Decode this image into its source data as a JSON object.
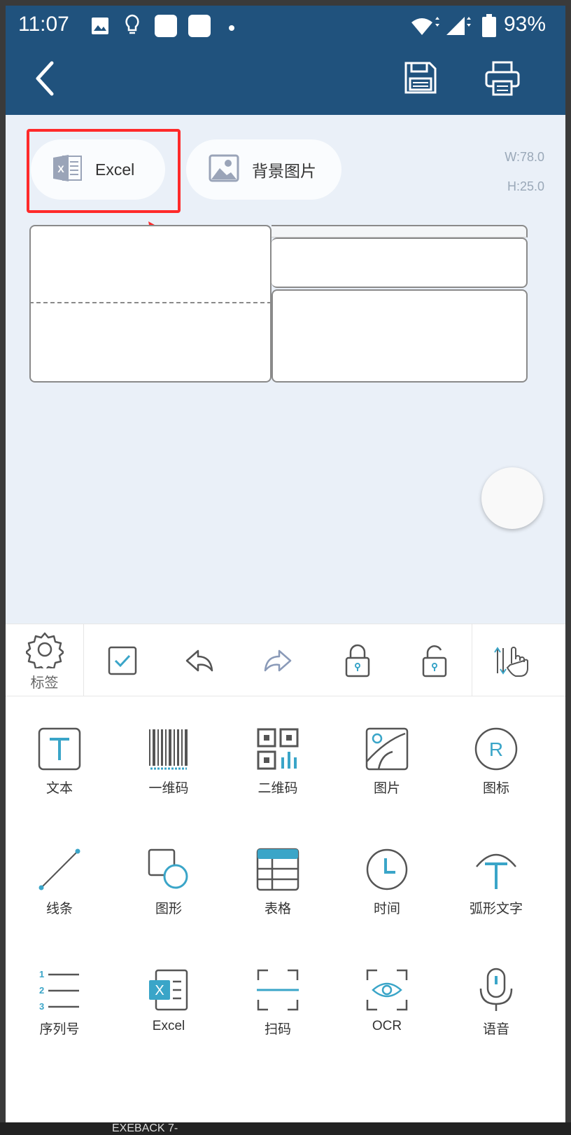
{
  "status_bar": {
    "time": "11:07",
    "battery": "93%"
  },
  "canvas": {
    "excel_button": "Excel",
    "background_button": "背景图片",
    "width_label": "W:78.0",
    "height_label": "H:25.0"
  },
  "toolbar": {
    "settings_label": "标签"
  },
  "tools": [
    {
      "label": "文本",
      "icon": "text-icon"
    },
    {
      "label": "一维码",
      "icon": "barcode-icon"
    },
    {
      "label": "二维码",
      "icon": "qrcode-icon"
    },
    {
      "label": "图片",
      "icon": "image-icon"
    },
    {
      "label": "图标",
      "icon": "registered-icon"
    },
    {
      "label": "线条",
      "icon": "line-icon"
    },
    {
      "label": "图形",
      "icon": "shape-icon"
    },
    {
      "label": "表格",
      "icon": "table-icon"
    },
    {
      "label": "时间",
      "icon": "clock-icon"
    },
    {
      "label": "弧形文字",
      "icon": "arc-text-icon"
    },
    {
      "label": "序列号",
      "icon": "serial-number-icon"
    },
    {
      "label": "Excel",
      "icon": "excel-icon"
    },
    {
      "label": "扫码",
      "icon": "scan-icon"
    },
    {
      "label": "OCR",
      "icon": "ocr-icon"
    },
    {
      "label": "语音",
      "icon": "microphone-icon"
    }
  ],
  "colors": {
    "header": "#20527d",
    "accent": "#3aa5c8",
    "canvas_bg": "#eaf0f8",
    "highlight": "#ff2a2a"
  },
  "bottom_text": "EXEBACK 7-"
}
